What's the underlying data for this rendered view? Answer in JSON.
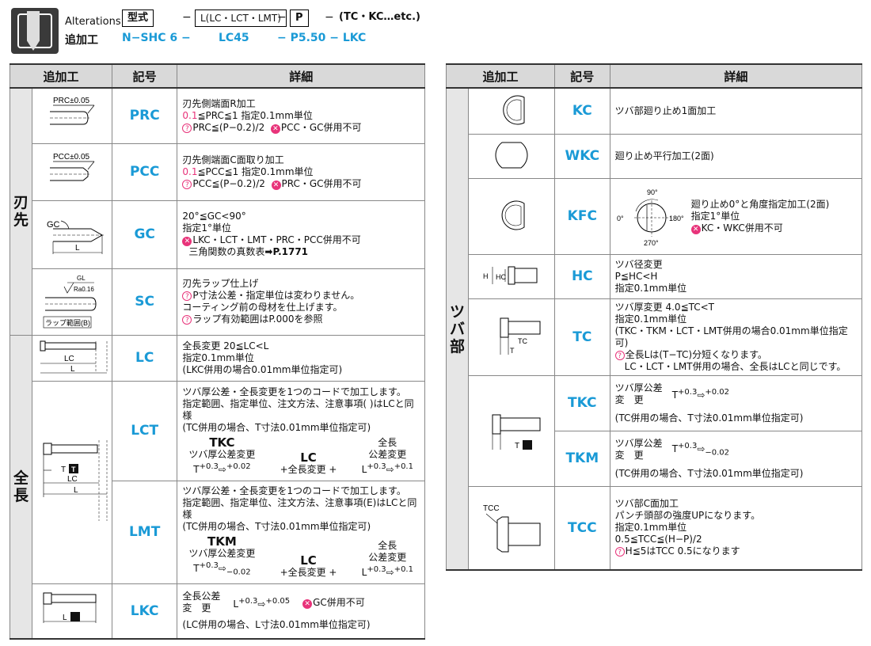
{
  "header": {
    "title_en": "Alterations",
    "title_jp": "追加工",
    "code_parts": [
      "型式",
      "L(LC・LCT・LMT)",
      "P",
      "(TC・KC…etc.)"
    ],
    "dash": "−",
    "example": [
      "N−SHC 6 −",
      "LC45",
      "− P5.50 − LKC"
    ]
  },
  "columns": {
    "alteration": "追加工",
    "code": "記号",
    "detail": "詳細"
  },
  "left": {
    "groups": [
      {
        "label": "刃先"
      },
      {
        "label": "全長"
      }
    ],
    "rows": [
      {
        "code": "PRC",
        "fig": [
          "PRC±0.05"
        ],
        "lines": [
          "刃先側端面R加工",
          "≦PRC≦1 指定0.1mm単位",
          "PRC≦(P−0.2)/2",
          "PCC・GC併用不可"
        ],
        "red": "0.1"
      },
      {
        "code": "PCC",
        "fig": [
          "PCC±0.05"
        ],
        "lines": [
          "刃先側端面C面取り加工",
          "≦PCC≦1 指定0.1mm単位",
          "PCC≦(P−0.2)/2",
          "PRC・GC併用不可"
        ],
        "red": "0.1"
      },
      {
        "code": "GC",
        "fig": [
          "GC",
          "L"
        ],
        "lines": [
          "20°≦GC<90°",
          "指定1°単位",
          "LKC・LCT・LMT・PRC・PCC併用不可",
          "三角関数の真数表",
          "P.1771"
        ]
      },
      {
        "code": "SC",
        "fig": [
          "GL",
          "Ra0.16",
          "ラップ範囲(B)"
        ],
        "lines": [
          "刃先ラップ仕上げ",
          "P寸法公差・指定単位は変わりません。",
          "コーティング前の母材を仕上げます。",
          "ラップ有効範囲はP.000を参照"
        ]
      },
      {
        "code": "LC",
        "fig": [
          "LC",
          "L"
        ],
        "lines": [
          "全長変更 20≦LC<L",
          "指定0.1mm単位",
          "(LKC併用の場合0.01mm単位指定可)"
        ]
      },
      {
        "code": "LCT",
        "fig": [
          "T",
          "LC",
          "L"
        ],
        "lines": [
          "ツバ厚公差・全長変更を1つのコードで加工します。",
          "指定範囲、指定単位、注文方法、注意事項( )はLCと同様",
          "(TC併用の場合、T寸法0.01mm単位指定可)"
        ],
        "sub": {
          "c1": [
            "TKC",
            "ツバ厚公差変更",
            "T"
          ],
          "c2": [
            "LC",
            "+全長変更 +"
          ],
          "c3": [
            "全長",
            "公差変更",
            "L"
          ]
        }
      },
      {
        "code": "LMT",
        "lines": [
          "ツバ厚公差・全長変更を1つのコードで加工します。",
          "指定範囲、指定単位、注文方法、注意事項(E)はLCと同様",
          "(TC併用の場合、T寸法0.01mm単位指定可)"
        ],
        "sub": {
          "c1": [
            "TKM",
            "ツバ厚公差変更",
            "T"
          ],
          "c2": [
            "LC",
            "+全長変更 +"
          ],
          "c3": [
            "全長",
            "公差変更",
            "L"
          ]
        }
      },
      {
        "code": "LKC",
        "fig": [
          "L"
        ],
        "lines": [
          "全長公差",
          "変　更",
          "L",
          "GC併用不可",
          "(LC併用の場合、L寸法0.01mm単位指定可)"
        ]
      }
    ]
  },
  "right": {
    "group": "ツバ部",
    "rows": [
      {
        "code": "KC",
        "lines": [
          "ツバ部廻り止め1面加工"
        ]
      },
      {
        "code": "WKC",
        "lines": [
          "廻り止め平行加工(2面)"
        ]
      },
      {
        "code": "KFC",
        "fig": [
          "90°",
          "0°",
          "180°",
          "270°"
        ],
        "lines": [
          "廻り止め0°と角度指定加工(2面)",
          "指定1°単位",
          "KC・WKC併用不可"
        ]
      },
      {
        "code": "HC",
        "fig": [
          "H",
          "HC"
        ],
        "lines": [
          "ツバ径変更",
          "P≦HC<H",
          "指定0.1mm単位"
        ]
      },
      {
        "code": "TC",
        "fig": [
          "TC",
          "T"
        ],
        "lines": [
          "ツバ厚変更 4.0≦TC<T",
          "指定0.1mm単位",
          "(TKC・TKM・LCT・LMT併用の場合0.01mm単位指定可)",
          "全長Lは(T−TC)分短くなります。",
          "LC・LCT・LMT併用の場合、全長はLCと同じです。"
        ]
      },
      {
        "code": "TKC",
        "fig": [
          "T"
        ],
        "lines": [
          "ツバ厚公差",
          "変　更",
          "T",
          "(TC併用の場合、T寸法0.01mm単位指定可)"
        ]
      },
      {
        "code": "TKM",
        "lines": [
          "ツバ厚公差",
          "変　更",
          "T",
          "(TC併用の場合、T寸法0.01mm単位指定可)"
        ]
      },
      {
        "code": "TCC",
        "fig": [
          "TCC"
        ],
        "lines": [
          "ツバ部C面加工",
          "パンチ頭部の強度UPになります。",
          "指定0.1mm単位",
          "0.5≦TCC≦(H−P)/2",
          "H≦5はTCC 0.5になります"
        ]
      }
    ]
  },
  "tolerances": {
    "tkc_from": [
      "+0.3",
      "0"
    ],
    "tkc_to": [
      "+0.02",
      "0"
    ],
    "tkm_to": [
      "0",
      "−0.02"
    ],
    "l_from": [
      "+0.3",
      "0"
    ],
    "l_to": [
      "+0.1",
      "0"
    ],
    "lkc_to": [
      "+0.05",
      "0"
    ]
  }
}
